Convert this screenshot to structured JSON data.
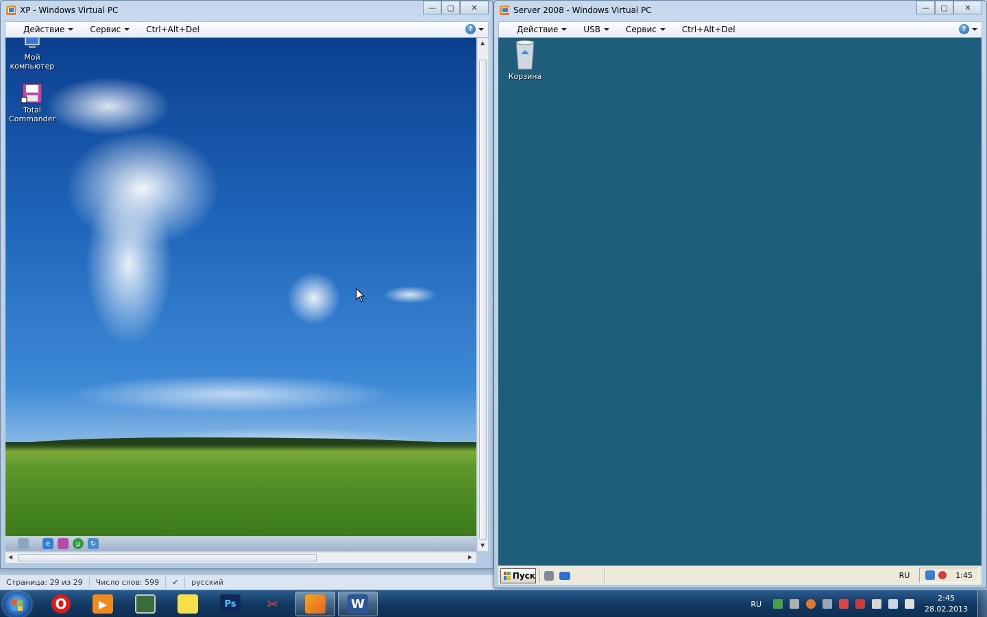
{
  "host": {
    "status_bar": {
      "page": "Страница: 29 из 29",
      "words": "Число слов: 599",
      "language": "русский"
    },
    "taskbar": {
      "apps": [
        {
          "name": "opera",
          "label": "O"
        },
        {
          "name": "media-player",
          "label": "▶"
        },
        {
          "name": "monitor",
          "label": ""
        },
        {
          "name": "paint",
          "label": ""
        },
        {
          "name": "photoshop",
          "label": "Ps"
        },
        {
          "name": "snipping-tool",
          "label": ""
        },
        {
          "name": "virtual-pc",
          "label": ""
        },
        {
          "name": "word",
          "label": "W"
        }
      ],
      "tray": {
        "language": "RU",
        "time": "2:45",
        "date": "28.02.2013"
      }
    }
  },
  "xp_window": {
    "title": "XP - Windows Virtual PC",
    "menu": [
      "Действие",
      "Сервис",
      "Ctrl+Alt+Del"
    ],
    "help": "?",
    "desktop_icons": [
      {
        "label": "Мой компьютер"
      },
      {
        "label": "Total Commander"
      }
    ]
  },
  "server_window": {
    "title": "Server 2008 - Windows Virtual PC",
    "menu": [
      "Действие",
      "USB",
      "Сервис",
      "Ctrl+Alt+Del"
    ],
    "help": "?",
    "desktop_icons": [
      {
        "label": "Корзина"
      }
    ],
    "taskbar": {
      "start": "Пуск",
      "language": "RU",
      "time": "1:45"
    }
  },
  "window_controls": {
    "minimize": "—",
    "maximize": "▢",
    "close": "✕"
  },
  "colors": {
    "server_desktop": "#1f5e7b",
    "host_taskbar": "#123a63",
    "opera_red": "#d81b1b",
    "word_blue": "#2b5797"
  }
}
